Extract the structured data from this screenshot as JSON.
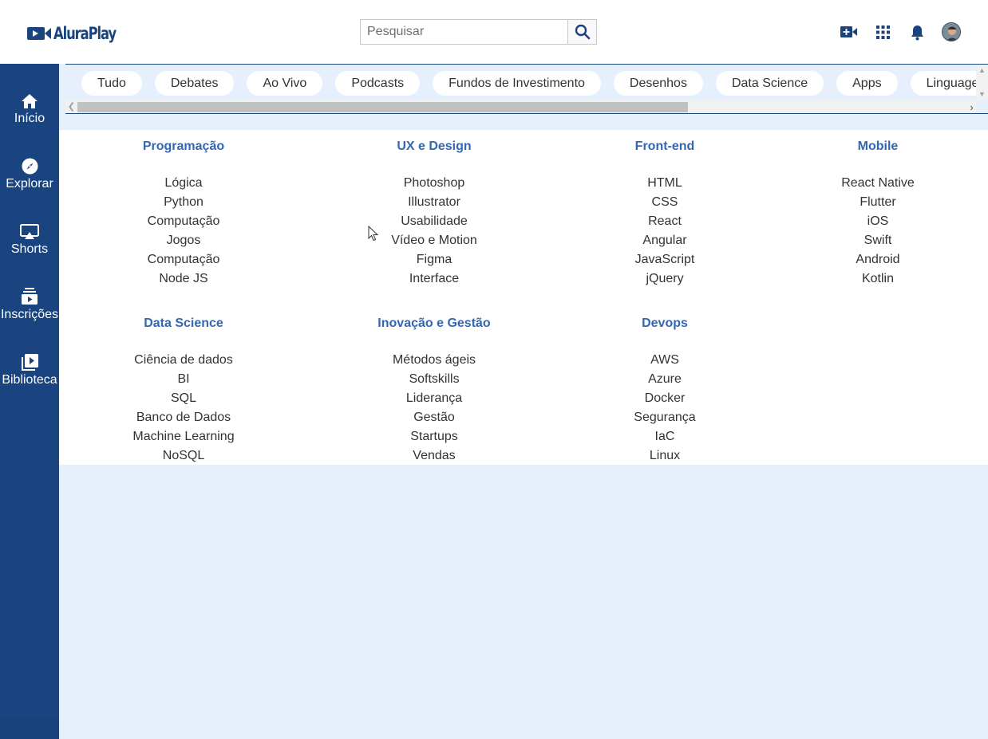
{
  "brand": {
    "name": "AluraPlay",
    "logo_icon": "video-camera-icon",
    "color": "#1a4480"
  },
  "search": {
    "placeholder": "Pesquisar",
    "value": "",
    "button_icon": "search-icon"
  },
  "header_icons": [
    "add-video-icon",
    "apps-grid-icon",
    "notification-bell-icon",
    "user-avatar"
  ],
  "sidebar": {
    "items": [
      {
        "label": "Início",
        "icon": "home-icon"
      },
      {
        "label": "Explorar",
        "icon": "compass-icon"
      },
      {
        "label": "Shorts",
        "icon": "cast-icon"
      },
      {
        "label": "Inscrições",
        "icon": "subscriptions-icon"
      },
      {
        "label": "Biblioteca",
        "icon": "library-icon"
      }
    ]
  },
  "chips": [
    "Tudo",
    "Debates",
    "Ao Vivo",
    "Podcasts",
    "Fundos de Investimento",
    "Desenhos",
    "Data Science",
    "Apps",
    "Linguagem"
  ],
  "menu": {
    "columns": [
      {
        "title": "Programação",
        "items": [
          "Lógica",
          "Python",
          "Computação",
          "Jogos",
          "Computação",
          "Node JS"
        ]
      },
      {
        "title": "UX e Design",
        "items": [
          "Photoshop",
          "Illustrator",
          "Usabilidade",
          "Vídeo e Motion",
          "Figma",
          "Interface"
        ]
      },
      {
        "title": "Front-end",
        "items": [
          "HTML",
          "CSS",
          "React",
          "Angular",
          "JavaScript",
          "jQuery"
        ]
      },
      {
        "title": "Mobile",
        "items": [
          "React Native",
          "Flutter",
          "iOS",
          "Swift",
          "Android",
          "Kotlin"
        ]
      },
      {
        "title": "Data Science",
        "items": [
          "Ciência de dados",
          "BI",
          "SQL",
          "Banco de Dados",
          "Machine Learning",
          "NoSQL"
        ]
      },
      {
        "title": "Inovação e Gestão",
        "items": [
          "Métodos ágeis",
          "Softskills",
          "Liderança",
          "Gestão",
          "Startups",
          "Vendas"
        ]
      },
      {
        "title": "Devops",
        "items": [
          "AWS",
          "Azure",
          "Docker",
          "Segurança",
          "IaC",
          "Linux"
        ]
      }
    ]
  },
  "colors": {
    "primary": "#1a4480",
    "link": "#3367b1",
    "background": "#e6f0fc"
  }
}
